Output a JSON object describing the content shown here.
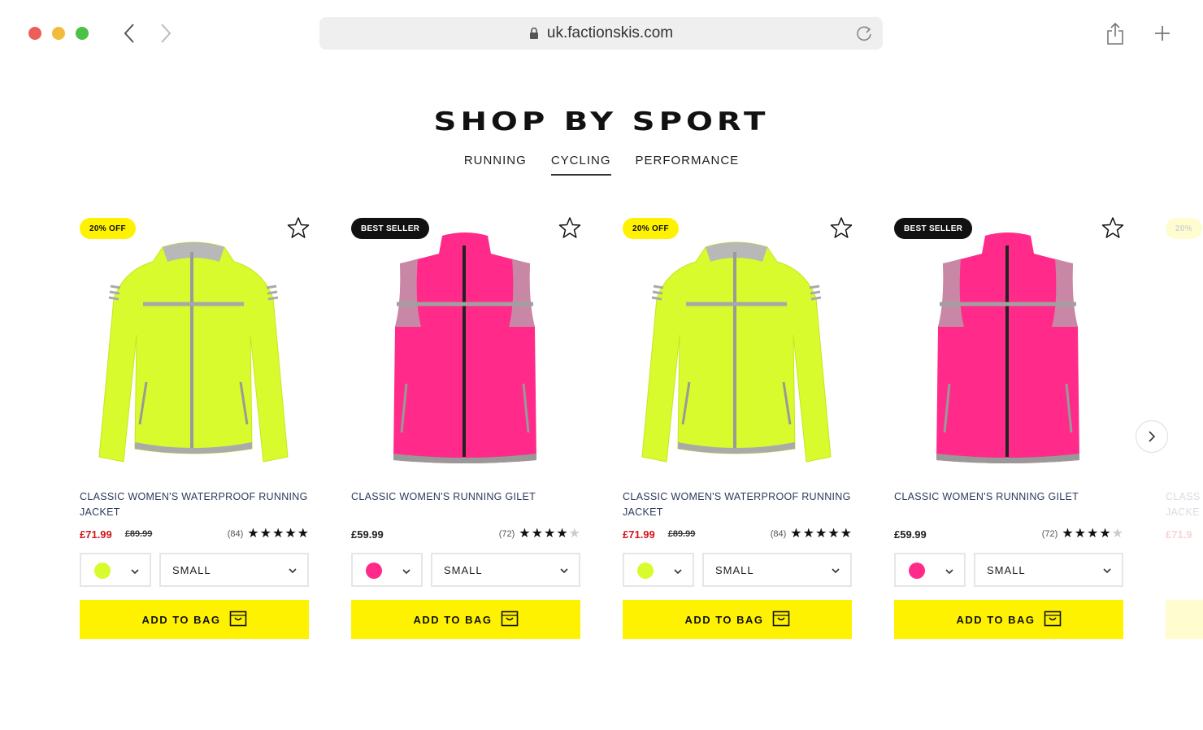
{
  "browser": {
    "url": "uk.factionskis.com"
  },
  "section": {
    "title": "SHOP BY SPORT",
    "tabs": [
      {
        "label": "RUNNING",
        "active": false
      },
      {
        "label": "CYCLING",
        "active": true
      },
      {
        "label": "PERFORMANCE",
        "active": false
      }
    ]
  },
  "products": [
    {
      "badge": "20% OFF",
      "badge_type": "sale",
      "garment": "jacket",
      "color": "#d8fb2e",
      "name": "CLASSIC WOMEN'S WATERPROOF RUNNING JACKET",
      "price": "£71.99",
      "was": "£89.99",
      "reviews": "(84)",
      "rating": 5,
      "swatch": "#d8fb2e",
      "size": "SMALL",
      "cta": "ADD TO BAG"
    },
    {
      "badge": "BEST SELLER",
      "badge_type": "best",
      "garment": "gilet",
      "color": "#ff2a8a",
      "name": "CLASSIC WOMEN'S RUNNING GILET",
      "price": "£59.99",
      "was": "",
      "reviews": "(72)",
      "rating": 4,
      "swatch": "#ff2a8a",
      "size": "SMALL",
      "cta": "ADD TO BAG"
    },
    {
      "badge": "20% OFF",
      "badge_type": "sale",
      "garment": "jacket",
      "color": "#d8fb2e",
      "name": "CLASSIC WOMEN'S WATERPROOF RUNNING JACKET",
      "price": "£71.99",
      "was": "£89.99",
      "reviews": "(84)",
      "rating": 5,
      "swatch": "#d8fb2e",
      "size": "SMALL",
      "cta": "ADD TO BAG"
    },
    {
      "badge": "BEST SELLER",
      "badge_type": "best",
      "garment": "gilet",
      "color": "#ff2a8a",
      "name": "CLASSIC WOMEN'S RUNNING GILET",
      "price": "£59.99",
      "was": "",
      "reviews": "(72)",
      "rating": 4,
      "swatch": "#ff2a8a",
      "size": "SMALL",
      "cta": "ADD TO BAG"
    }
  ],
  "partial_card": {
    "badge": "20%",
    "name": "CLASS JACKE",
    "price": "£71.9"
  },
  "colors": {
    "accent": "#fff200",
    "sale_price": "#d4161c"
  }
}
